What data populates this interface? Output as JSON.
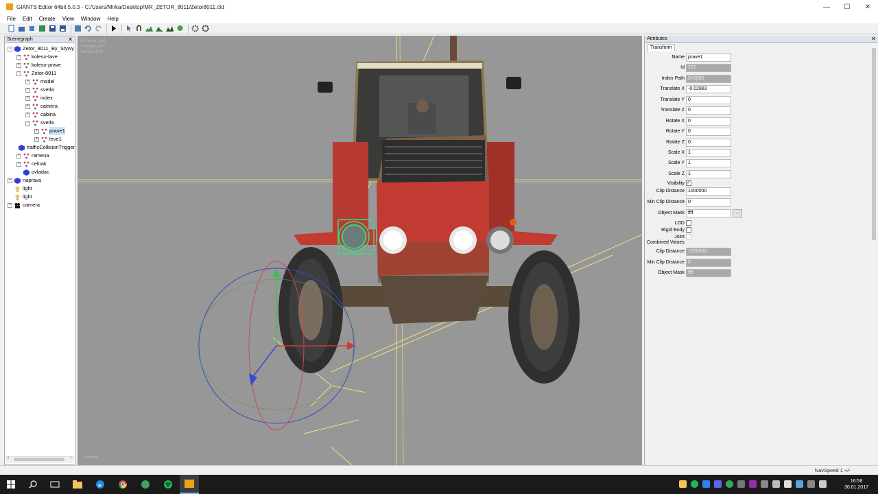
{
  "window": {
    "title": "GIANTS Editor 64bit 5.0.3 - C:/Users/Mirka/Desktop/MR_ZETOR_8011/Zetor8011.i3d",
    "minimize": "—",
    "maximize": "☐",
    "close": "✕"
  },
  "menu": [
    "File",
    "Edit",
    "Create",
    "View",
    "Window",
    "Help"
  ],
  "scenegraph": {
    "title": "Scenegraph",
    "close": "✕",
    "nodes": [
      {
        "label": "Zetor_8011_By_Stywy",
        "icon": "transform-cube-icon"
      },
      {
        "label": "koleso-lave",
        "icon": "shape-icon"
      },
      {
        "label": "koleso-prave",
        "icon": "shape-icon"
      },
      {
        "label": "Zetor-8011",
        "icon": "shape-icon"
      },
      {
        "label": "model",
        "icon": "shape-icon"
      },
      {
        "label": "svetla",
        "icon": "shape-icon"
      },
      {
        "label": "index",
        "icon": "shape-icon"
      },
      {
        "label": "camera",
        "icon": "shape-icon"
      },
      {
        "label": "cabina",
        "icon": "shape-icon"
      },
      {
        "label": "svetla",
        "icon": "shape-icon"
      },
      {
        "label": "prave1",
        "icon": "shape-icon"
      },
      {
        "label": "leve1",
        "icon": "shape-icon"
      },
      {
        "label": "trafficCollisionTrigger",
        "icon": "transform-cube-icon"
      },
      {
        "label": "ramena",
        "icon": "shape-icon"
      },
      {
        "label": "celnak",
        "icon": "shape-icon"
      },
      {
        "label": "ovladac",
        "icon": "transform-cube-icon"
      },
      {
        "label": "naprava",
        "icon": "transform-cube-icon"
      },
      {
        "label": "light",
        "icon": "light-bulb-icon"
      },
      {
        "label": "light",
        "icon": "light-bulb-icon"
      },
      {
        "label": "camera",
        "icon": "camera-icon"
      }
    ]
  },
  "viewport": {
    "stats": [
      "Distance 2.58",
      "Triangles 867",
      "Vertices 838"
    ],
    "camera_label": "camera"
  },
  "attributes": {
    "title": "Attributes",
    "close": "✕",
    "tab": "Transform",
    "fields": [
      {
        "label": "Name",
        "value": "prave1",
        "readonly": false
      },
      {
        "label": "Id",
        "value": "237",
        "readonly": true
      },
      {
        "label": "Index Path",
        "value": "0>2|5|0",
        "readonly": true
      },
      {
        "label": "Translate X",
        "value": "-0.02883",
        "readonly": false
      },
      {
        "label": "Translate Y",
        "value": "0",
        "readonly": false
      },
      {
        "label": "Translate Z",
        "value": "0",
        "readonly": false
      },
      {
        "label": "Rotate X",
        "value": "0",
        "readonly": false
      },
      {
        "label": "Rotate Y",
        "value": "0",
        "readonly": false
      },
      {
        "label": "Rotate Z",
        "value": "0",
        "readonly": false
      },
      {
        "label": "Scale X",
        "value": "1",
        "readonly": false
      },
      {
        "label": "Scale Y",
        "value": "1",
        "readonly": false
      },
      {
        "label": "Scale Z",
        "value": "1",
        "readonly": false
      }
    ],
    "visibility_label": "Visibility",
    "visibility_checked": true,
    "clip_distance_label": "Clip Distance",
    "clip_distance": "1000000",
    "min_clip_distance_label": "Min Clip Distance",
    "min_clip_distance": "0",
    "object_mask_label": "Object Mask",
    "object_mask": "ffff",
    "object_mask_button": "...",
    "lod_label": "LOD",
    "rigid_body_label": "Rigid Body",
    "joint_label": "Joint",
    "combined_values_label": "Combined Values",
    "combined": [
      {
        "label": "Clip Distance",
        "value": "1000000"
      },
      {
        "label": "Min Clip Distance",
        "value": "0"
      },
      {
        "label": "Object Mask",
        "value": "ffff"
      }
    ]
  },
  "status": {
    "navspeed": "NavSpeed 1 +/-"
  },
  "clock": {
    "time": "16:58",
    "date": "30.01.2017"
  },
  "colors": {
    "accent": "#76b9ed",
    "viewport_bg": "#979797",
    "readonly_field": "#a9a9a9"
  }
}
